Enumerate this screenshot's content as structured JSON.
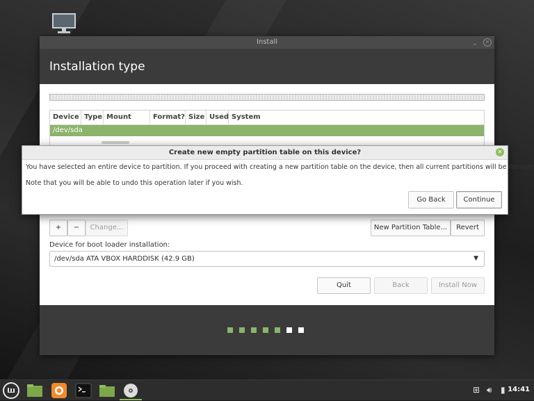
{
  "installer": {
    "window_title": "Install",
    "heading": "Installation type",
    "columns": [
      "Device",
      "Type",
      "Mount point",
      "Format?",
      "Size",
      "Used",
      "System"
    ],
    "selected_row": "/dev/sda",
    "add_label": "+",
    "remove_label": "−",
    "change_label": "Change...",
    "new_table_label": "New Partition Table...",
    "revert_label": "Revert",
    "bootloader_label": "Device for boot loader installation:",
    "bootloader_value": "/dev/sda ATA VBOX HARDDISK (42.9 GB)",
    "quit_label": "Quit",
    "back_label": "Back",
    "install_label": "Install Now",
    "progress_steps": 7,
    "progress_done": 5
  },
  "dialog": {
    "title": "Create new empty partition table on this device?",
    "message": "You have selected an entire device to partition. If you proceed with creating a new partition table on the device, then all current partitions will be removed.",
    "note": "Note that you will be able to undo this operation later if you wish.",
    "go_back_label": "Go Back",
    "continue_label": "Continue"
  },
  "taskbar": {
    "clock": "14:41",
    "icons": [
      "mint-menu-icon",
      "files-icon",
      "firefox-icon",
      "terminal-icon",
      "folder-icon",
      "disc-icon"
    ]
  },
  "colors": {
    "accent": "#8cb46b",
    "header": "#3b3b3b"
  }
}
